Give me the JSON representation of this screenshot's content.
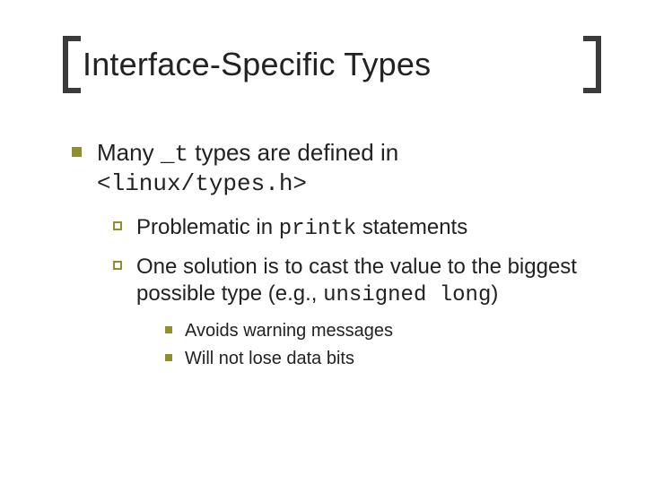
{
  "title": "Interface-Specific Types",
  "lvl1": {
    "prefix": "Many ",
    "code1": "_t",
    "mid": " types are defined in ",
    "code2": "<linux/types.h>"
  },
  "lvl2a": {
    "prefix": "Problematic in ",
    "code": "printk",
    "suffix": " statements"
  },
  "lvl2b": {
    "prefix": "One solution is to cast the value to the biggest possible type (e.g., ",
    "code": "unsigned long",
    "suffix": ")"
  },
  "lvl3a": "Avoids warning messages",
  "lvl3b": "Will not lose data bits"
}
